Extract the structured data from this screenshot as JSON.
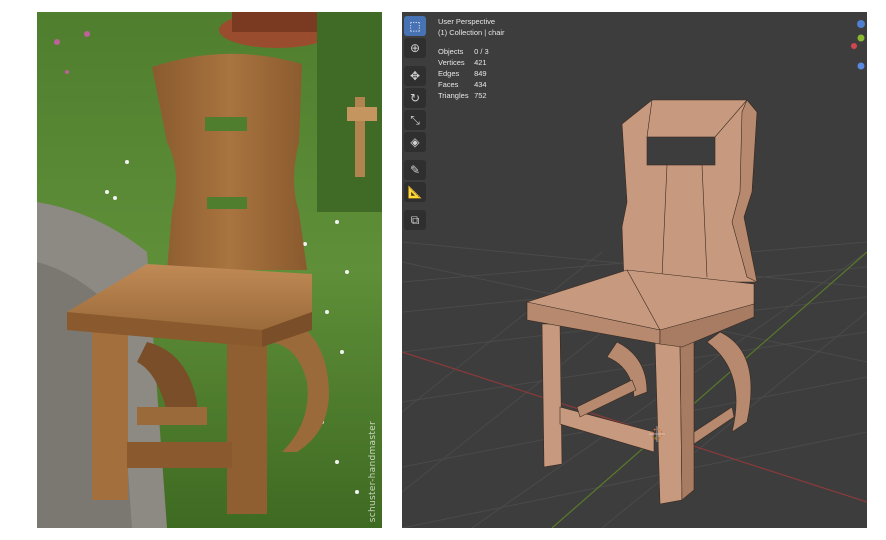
{
  "photo": {
    "watermark": "schuster-handmaster"
  },
  "viewport": {
    "view_name": "User Perspective",
    "collection": "(1) Collection | chair",
    "stats": [
      {
        "label": "Objects",
        "value": "0 / 3"
      },
      {
        "label": "Vertices",
        "value": "421"
      },
      {
        "label": "Edges",
        "value": "849"
      },
      {
        "label": "Faces",
        "value": "434"
      },
      {
        "label": "Triangles",
        "value": "752"
      }
    ]
  },
  "toolbar": {
    "tools": [
      "select-box",
      "cursor",
      "move",
      "rotate",
      "scale",
      "transform",
      "annotate",
      "measure",
      "add-cube"
    ]
  },
  "colors": {
    "viewport_bg": "#3d3d3d",
    "model_color": "#c7997e",
    "toolbar_active": "#4772b3",
    "x_axis": "#8a3a3a",
    "y_axis": "#5a7a2a"
  }
}
